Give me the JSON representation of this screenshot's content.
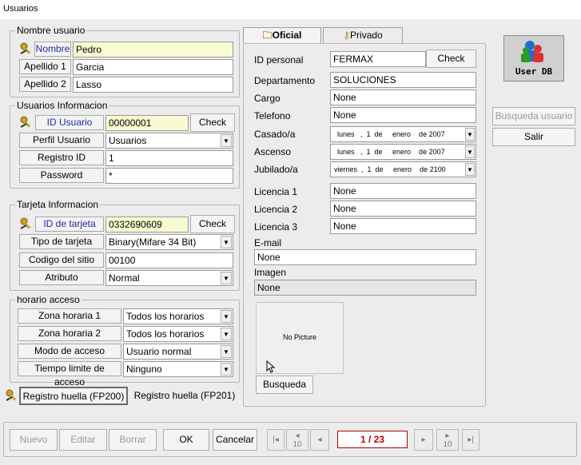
{
  "window": {
    "title": "Usuarios"
  },
  "nombre_group": {
    "title": "Nombre usuario",
    "nombre_label": "Nombre",
    "nombre_value": "Pedro",
    "apellido1_label": "Apellido 1",
    "apellido1_value": "Garcia",
    "apellido2_label": "Apellido 2",
    "apellido2_value": "Lasso"
  },
  "usuarios_group": {
    "title": "Usuarios Informacion",
    "id_label": "ID Usuario",
    "id_value": "00000001",
    "check_label": "Check",
    "perfil_label": "Perfil Usuario",
    "perfil_value": "Usuarios",
    "registro_label": "Registro ID",
    "registro_value": "1",
    "password_label": "Password",
    "password_value": "*"
  },
  "tarjeta_group": {
    "title": "Tarjeta Informacion",
    "id_label": "ID de tarjeta",
    "id_value": "0332690609",
    "check_label": "Check",
    "tipo_label": "Tipo de tarjeta",
    "tipo_value": "Binary(Mifare 34 Bit)",
    "codigo_label": "Codigo del sitio",
    "codigo_value": "00100",
    "atributo_label": "Atributo",
    "atributo_value": "Normal"
  },
  "horario_group": {
    "title": "horario acceso",
    "zona1_label": "Zona horaria 1",
    "zona1_value": "Todos los horarios",
    "zona2_label": "Zona horaria 2",
    "zona2_value": "Todos los horarios",
    "modo_label": "Modo de acceso",
    "modo_value": "Usuario normal",
    "tiempo_label": "Tiempo limite de acceso",
    "tiempo_value": "Ninguno"
  },
  "huella": {
    "fp200_label": "Registro huella (FP200)",
    "fp201_label": "Registro huella (FP201)"
  },
  "tabs": {
    "oficial": "Oficial",
    "privado": "Privado"
  },
  "oficial": {
    "id_personal_label": "ID personal",
    "id_personal_value": "FERMAX",
    "check_label": "Check",
    "departamento_label": "Departamento",
    "departamento_value": "SOLUCIONES",
    "cargo_label": "Cargo",
    "cargo_value": "None",
    "telefono_label": "Telefono",
    "telefono_value": "None",
    "casado_label": "Casado/a",
    "casado_value": "lunes   ,  1  de     enero    de 2007",
    "ascenso_label": "Ascenso",
    "ascenso_value": "lunes   ,  1  de     enero    de 2007",
    "jubilado_label": "Jubilado/a",
    "jubilado_value": "viernes  ,  1  de     enero    de 2100",
    "licencia1_label": "Licencia 1",
    "licencia1_value": "None",
    "licencia2_label": "Licencia 2",
    "licencia2_value": "None",
    "licencia3_label": "Licencia 3",
    "licencia3_value": "None",
    "email_label": "E-mail",
    "email_value": "None",
    "imagen_label": "Imagen",
    "imagen_value": "None",
    "no_picture": "No Picture",
    "busqueda_label": "Busqueda"
  },
  "right_panel": {
    "userdb_label": "User DB",
    "busqueda_usuario": "Busqueda usuario",
    "salir": "Salir"
  },
  "bottom": {
    "nuevo": "Nuevo",
    "editar": "Editar",
    "borrar": "Borrar",
    "ok": "OK",
    "cancelar": "Cancelar",
    "record_counter": "1 / 23",
    "step": "10"
  }
}
